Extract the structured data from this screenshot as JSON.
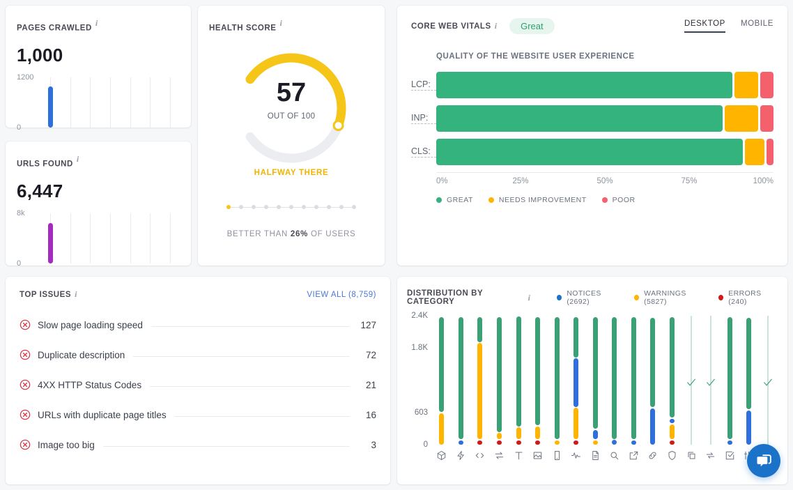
{
  "pages_crawled": {
    "title": "PAGES CRAWLED",
    "value": "1,000",
    "axis_top": "1200",
    "axis_bottom": "0",
    "bar_color": "#2f6fdb"
  },
  "urls_found": {
    "title": "URLS FOUND",
    "value": "6,447",
    "axis_top": "8k",
    "axis_bottom": "0",
    "bar_color": "#a32bbd"
  },
  "health_score": {
    "title": "HEALTH SCORE",
    "score": "57",
    "out_of": "OUT OF 100",
    "caption": "HALFWAY THERE",
    "better_than_prefix": "BETTER THAN",
    "better_than_value": "26%",
    "better_than_suffix": "OF USERS",
    "arc_color": "#f5c518",
    "track_color": "#ebedf0",
    "dots_total": 11,
    "dots_active_index": 0
  },
  "core_web_vitals": {
    "title": "CORE WEB VITALS",
    "badge": "Great",
    "tabs": [
      {
        "label": "DESKTOP",
        "active": true
      },
      {
        "label": "MOBILE",
        "active": false
      }
    ],
    "subtitle": "QUALITY OF THE WEBSITE USER EXPERIENCE",
    "rows": [
      {
        "label": "LCP:",
        "great": 89,
        "needs": 7,
        "poor": 4
      },
      {
        "label": "INP:",
        "great": 86,
        "needs": 10,
        "poor": 4
      },
      {
        "label": "CLS:",
        "great": 92,
        "needs": 6,
        "poor": 2
      }
    ],
    "axis_ticks": [
      "0%",
      "25%",
      "50%",
      "75%",
      "100%"
    ],
    "legend": [
      {
        "label": "GREAT",
        "color": "#35b37e"
      },
      {
        "label": "NEEDS IMPROVEMENT",
        "color": "#ffb400"
      },
      {
        "label": "POOR",
        "color": "#f5606d"
      }
    ]
  },
  "top_issues": {
    "title": "TOP ISSUES",
    "view_all": "VIEW ALL (8,759)",
    "items": [
      {
        "name": "Slow page loading speed",
        "count": "127"
      },
      {
        "name": "Duplicate description",
        "count": "72"
      },
      {
        "name": "4XX HTTP Status Codes",
        "count": "21"
      },
      {
        "name": "URLs with duplicate page titles",
        "count": "16"
      },
      {
        "name": "Image too big",
        "count": "3"
      }
    ],
    "icon_color": "#d93a4a"
  },
  "distribution": {
    "title": "DISTRIBUTION BY CATEGORY",
    "legend": [
      {
        "label": "NOTICES (2692)",
        "color": "#1a73c8"
      },
      {
        "label": "WARNINGS (5827)",
        "color": "#ffb400"
      },
      {
        "label": "ERRORS (240)",
        "color": "#d01a1a"
      }
    ],
    "colors": {
      "great": "#3aa076",
      "notices": "#2f6fdb",
      "warnings": "#ffb400",
      "errors": "#d01a1a"
    }
  },
  "chart_data": {
    "type": "bar",
    "title": "Distribution by Category",
    "ylabel": "",
    "xlabel": "",
    "ylim": [
      0,
      2400
    ],
    "ytick_labels": [
      "0",
      "603",
      "1.8K",
      "2.4K"
    ],
    "ytick_values": [
      0,
      603,
      1800,
      2400
    ],
    "grid": false,
    "legend_position": "top-right",
    "series": [
      {
        "name": "Great",
        "color": "#3aa076"
      },
      {
        "name": "Notices",
        "color": "#2f6fdb"
      },
      {
        "name": "Warnings",
        "color": "#ffb400"
      },
      {
        "name": "Errors",
        "color": "#d01a1a"
      }
    ],
    "categories": [
      "crawlability",
      "performance",
      "code",
      "redirects",
      "text",
      "image",
      "mobile",
      "analytics",
      "document",
      "search",
      "external-link",
      "link",
      "shield",
      "copy",
      "sync",
      "checkbox",
      "sliders",
      "misc"
    ],
    "columns": [
      {
        "icon": "cube-icon",
        "empty": false,
        "great": 1800,
        "notices": 0,
        "warnings": 600,
        "errors": 0
      },
      {
        "icon": "lightning-icon",
        "empty": false,
        "great": 2400,
        "notices": 40,
        "warnings": 0,
        "errors": 0
      },
      {
        "icon": "code-icon",
        "empty": false,
        "great": 500,
        "notices": 0,
        "warnings": 1900,
        "errors": 40
      },
      {
        "icon": "redirect-icon",
        "empty": false,
        "great": 2250,
        "notices": 0,
        "warnings": 120,
        "errors": 40
      },
      {
        "icon": "text-icon",
        "empty": false,
        "great": 2150,
        "notices": 0,
        "warnings": 230,
        "errors": 40
      },
      {
        "icon": "image-icon",
        "empty": false,
        "great": 2130,
        "notices": 0,
        "warnings": 250,
        "errors": 40
      },
      {
        "icon": "mobile-icon",
        "empty": false,
        "great": 2360,
        "notices": 0,
        "warnings": 40,
        "errors": 0
      },
      {
        "icon": "analytics-icon",
        "empty": false,
        "great": 800,
        "notices": 950,
        "warnings": 620,
        "errors": 40
      },
      {
        "icon": "document-icon",
        "empty": false,
        "great": 2180,
        "notices": 180,
        "warnings": 60,
        "errors": 0
      },
      {
        "icon": "search-icon",
        "empty": false,
        "great": 2320,
        "notices": 50,
        "warnings": 0,
        "errors": 0
      },
      {
        "icon": "external-link-icon",
        "empty": false,
        "great": 2340,
        "notices": 40,
        "warnings": 0,
        "errors": 0
      },
      {
        "icon": "link-icon",
        "empty": false,
        "great": 1660,
        "notices": 680,
        "warnings": 0,
        "errors": 0
      },
      {
        "icon": "shield-icon",
        "empty": false,
        "great": 2000,
        "notices": 60,
        "warnings": 300,
        "errors": 40
      },
      {
        "icon": "copy-icon",
        "empty": true,
        "great": 0,
        "notices": 0,
        "warnings": 0,
        "errors": 0
      },
      {
        "icon": "sync-icon",
        "empty": true,
        "great": 0,
        "notices": 0,
        "warnings": 0,
        "errors": 0
      },
      {
        "icon": "checkbox-icon",
        "empty": false,
        "great": 2350,
        "notices": 40,
        "warnings": 0,
        "errors": 0
      },
      {
        "icon": "sliders-icon",
        "empty": false,
        "great": 1700,
        "notices": 640,
        "warnings": 0,
        "errors": 0
      },
      {
        "icon": "u-icon",
        "empty": true,
        "great": 0,
        "notices": 0,
        "warnings": 0,
        "errors": 0
      }
    ]
  },
  "chat": {
    "label": "chat"
  }
}
